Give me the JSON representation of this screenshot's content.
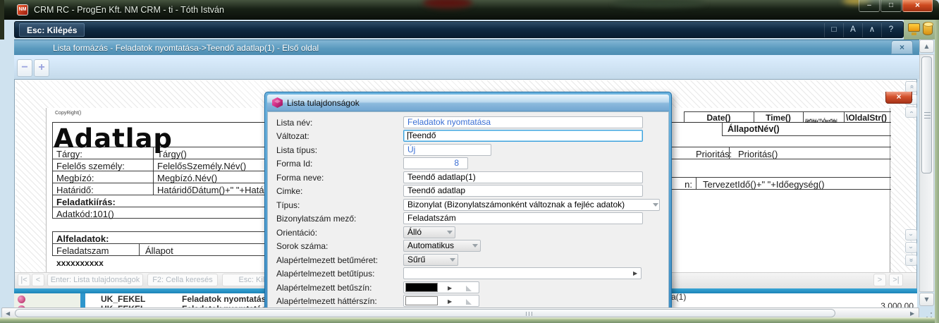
{
  "window": {
    "icon": "NM",
    "title": "CRM RC - ProgEn Kft. NM CRM - ti - Tóth István",
    "minimize": "–",
    "maximize": "□",
    "close": "×"
  },
  "menubar": {
    "exit": "Esc: Kilépés",
    "buttons": [
      "□",
      "A",
      "∧",
      "?"
    ]
  },
  "tabbar": {
    "title": "Lista formázás - Feladatok nyomtatása->Teendő adatlap(1) - Első oldal",
    "close": "×"
  },
  "toolbar": {
    "minus": "−",
    "plus": "+"
  },
  "preview": {
    "copyright": "CopyRight()",
    "heading": "Adatlap",
    "header_cells": [
      "Date()",
      "Time()",
      "AktOldal+\"/\"+ÖsszOldal",
      "\\OldalStr()"
    ],
    "allapot_nev": "ÁllapotNév()",
    "rows": [
      {
        "label": "Tárgy:",
        "value": "Tárgy()"
      },
      {
        "label": "Felelős személy:",
        "value": "FelelősSzemély.Név()"
      },
      {
        "label": "Megbízó:",
        "value": "Megbízó.Név()"
      },
      {
        "label": "Határidő:",
        "value": "HatáridőDátum()+\" \"+Határi"
      }
    ],
    "feladatkiiras": "Feladatkiírás:",
    "adatkod": "Adatkód:101()",
    "alfeladatok": "Alfeladatok:",
    "sub_header": [
      "Feladatszam",
      "Állapot"
    ],
    "placeholder_xs": "xxxxxxxxxx",
    "prioritas_label": "Prioritás:",
    "prioritas_value": "Prioritás()",
    "tervezett_label_fragment": "n:",
    "tervezett_value": "TervezetIdő()+\" \"+Időegység()"
  },
  "dialog": {
    "title": "Lista tulajdonságok",
    "close": "×",
    "fields": [
      {
        "label": "Lista név:",
        "value": "Feladatok nyomtatása"
      },
      {
        "label": "Változat:",
        "value": "Teendő"
      },
      {
        "label": "Lista típus:",
        "value": "Új"
      },
      {
        "label": "Forma Id:",
        "value": "8"
      },
      {
        "label": "Forma neve:",
        "value": "Teendő adatlap(1)"
      },
      {
        "label": "Cimke:",
        "value": "Teendő adatlap"
      },
      {
        "label": "Típus:",
        "value": "Bizonylat (Bizonylatszámonként változnak a fejléc adatok)"
      },
      {
        "label": "Bizonylatszám mező:",
        "value": "Feladatszám"
      },
      {
        "label": "Orientáció:",
        "value": "Álló"
      },
      {
        "label": "Sorok száma:",
        "value": "Automatikus"
      },
      {
        "label": "Alapértelmezett betűméret:",
        "value": "Sűrű"
      },
      {
        "label": "Alapértelmezett betűtípus:",
        "value": ""
      },
      {
        "label": "Alapértelmezett betűszín:",
        "value": "#000000"
      },
      {
        "label": "Alapértelmezett háttérszín:",
        "value": "#ffffff"
      }
    ]
  },
  "statusbar": {
    "first": "|<",
    "prev": "<",
    "enter": "Enter: Lista tulajdonságok",
    "f2": "F2: Cella keresés",
    "esc": "Esc: Kilép",
    "next": ">",
    "last": ">|"
  },
  "background_window": {
    "rows": [
      {
        "code": "UK_FEKEL",
        "name": "Feladatok nyomtatása"
      },
      {
        "code": "UK_FEKEL",
        "name": "Feladatok nyomtatás"
      }
    ],
    "fragment_right": "a(1)",
    "amount": "3.000,00"
  },
  "glyphs": {
    "up": "▲",
    "down": "▼",
    "left": "◀",
    "right": "▶",
    "chev": "‹",
    "chev_double": "«",
    "play": "▶"
  },
  "colors": {
    "accent_blue": "#2e94c8",
    "field_text_blue": "#3b6fd4",
    "font_color_swatch": "#000000",
    "background_color_swatch": "#ffffff",
    "partial_swatch": "#111111"
  }
}
